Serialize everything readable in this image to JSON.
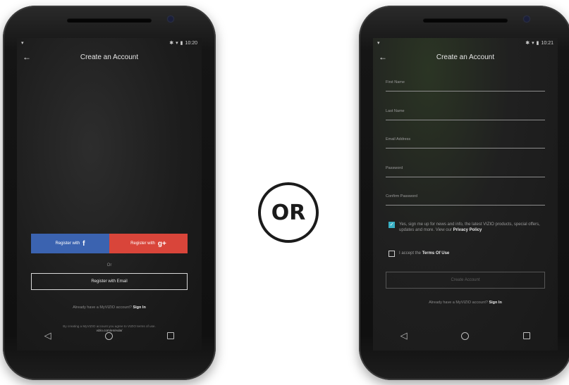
{
  "left_phone": {
    "status_time": "10:20",
    "title": "Create an Account",
    "facebook_label": "Register with",
    "facebook_glyph": "f",
    "google_label": "Register with",
    "google_glyph": "g+",
    "or_text": "Or",
    "email_button": "Register with Email",
    "already_text": "Already have a MyVIZIO account?",
    "sign_in": "Sign In",
    "terms_text": "By creating a MyVIZIO account you agree to VIZIO terms of use.",
    "terms_link": "vizio.com/en/eula/"
  },
  "or_badge": "OR",
  "right_phone": {
    "status_time": "10:21",
    "title": "Create an Account",
    "fields": [
      {
        "label": "First Name"
      },
      {
        "label": "Last Name"
      },
      {
        "label": "Email Address"
      },
      {
        "label": "Password"
      },
      {
        "label": "Confirm Password"
      }
    ],
    "newsletter_text": "Yes, sign me up for news and info, the latest VIZIO products, special offers, updates and more. View our",
    "newsletter_link": "Privacy Policy",
    "newsletter_checked": true,
    "terms_prefix": "I accept the",
    "terms_link": "Terms Of Use",
    "terms_checked": false,
    "create_button": "Create Account",
    "already_text": "Already have a MyVIZIO account?",
    "sign_in": "Sign In"
  },
  "colors": {
    "facebook": "#3b63b0",
    "google": "#d9453a",
    "checkbox_accent": "#39b0c4"
  },
  "icons": [
    "back-arrow-icon",
    "wifi-icon",
    "battery-icon",
    "nav-back-icon",
    "nav-home-icon",
    "nav-recent-icon"
  ]
}
